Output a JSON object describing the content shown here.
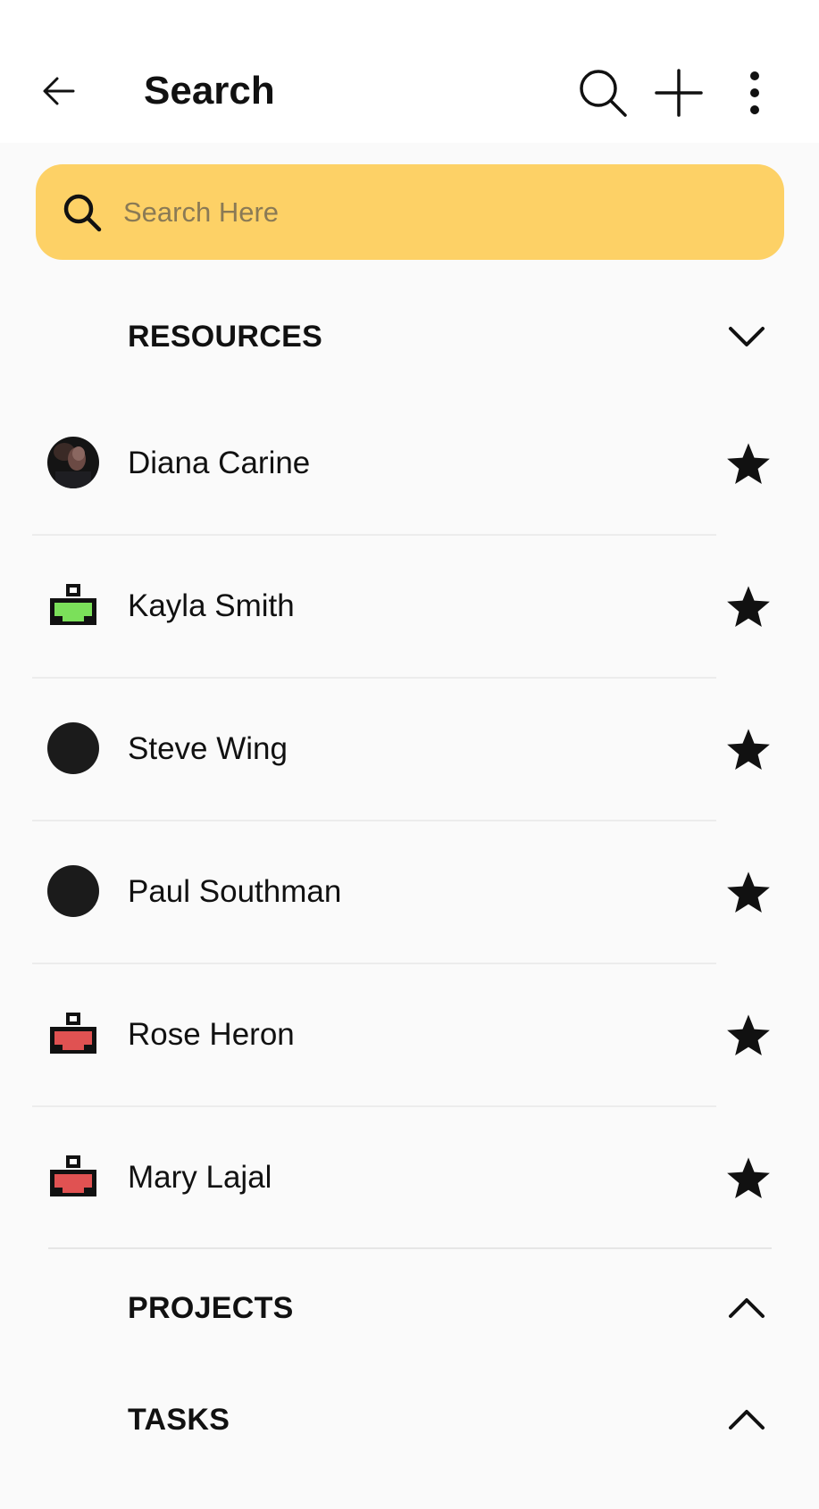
{
  "appbar": {
    "title": "Search",
    "back_icon": "arrow-left-icon",
    "actions": [
      "search-icon",
      "plus-icon",
      "more-vertical-icon"
    ]
  },
  "search": {
    "placeholder": "Search Here",
    "value": "",
    "background": "#fdd166"
  },
  "sections": [
    {
      "label": "RESOURCES",
      "state": "expanded",
      "chevron": "chevron-down-icon"
    },
    {
      "label": "PROJECTS",
      "state": "collapsed",
      "chevron": "chevron-up-icon"
    },
    {
      "label": "TASKS",
      "state": "collapsed",
      "chevron": "chevron-up-icon"
    }
  ],
  "resources": [
    {
      "name": "Diana Carine",
      "avatar": "photo-avatar",
      "favorite": true
    },
    {
      "name": "Kayla Smith",
      "avatar": "green-resource-icon",
      "avatar_color": "#7be05a",
      "favorite": true
    },
    {
      "name": "Steve Wing",
      "avatar": "dark-circle-avatar",
      "favorite": true
    },
    {
      "name": "Paul Southman",
      "avatar": "dark-circle-avatar",
      "favorite": true
    },
    {
      "name": "Rose Heron",
      "avatar": "red-resource-icon",
      "avatar_color": "#e05252",
      "favorite": true
    },
    {
      "name": "Mary Lajal",
      "avatar": "red-resource-icon",
      "avatar_color": "#e05252",
      "favorite": true
    }
  ]
}
